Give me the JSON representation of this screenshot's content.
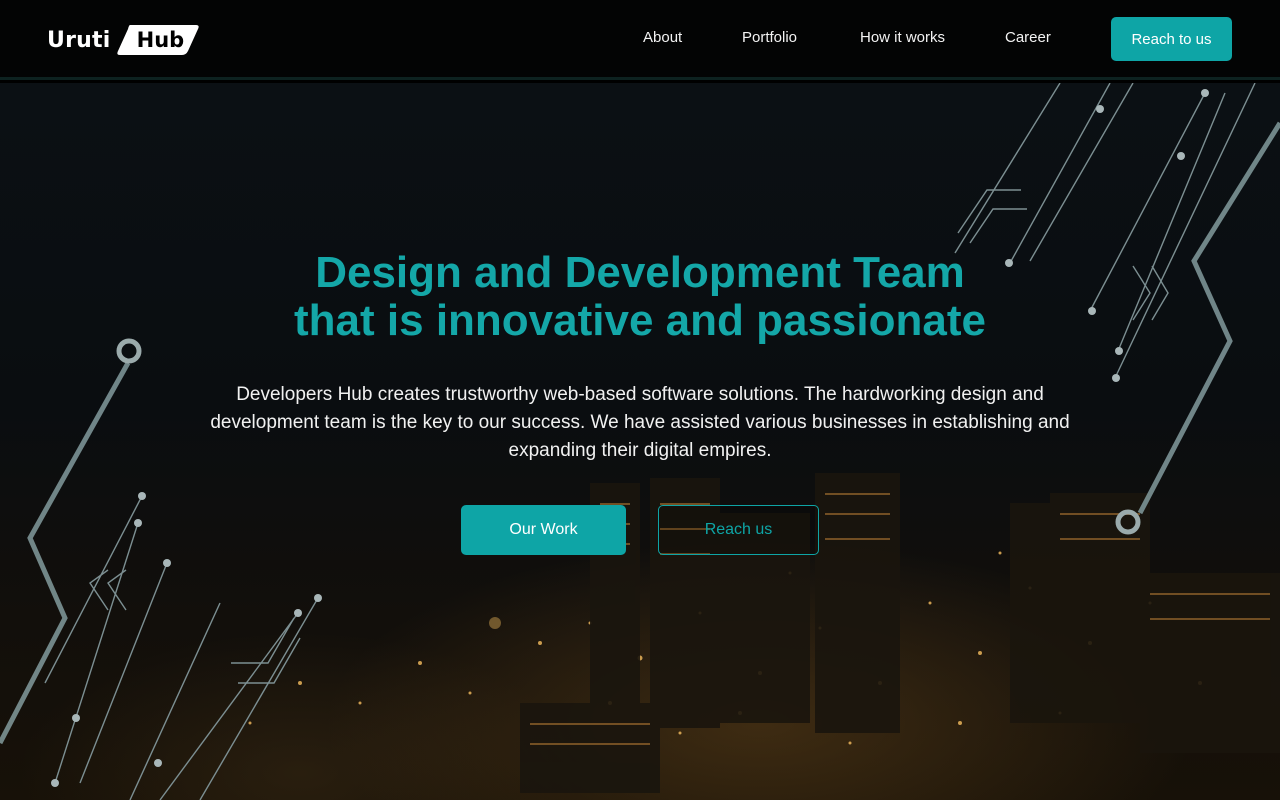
{
  "brand": {
    "word": "Uruti",
    "badge": "Hub"
  },
  "nav": {
    "links": [
      {
        "label": "About"
      },
      {
        "label": "Portfolio"
      },
      {
        "label": "How it works"
      },
      {
        "label": "Career"
      }
    ],
    "cta_label": "Reach to us"
  },
  "hero": {
    "headline_line1": "Design and Development Team",
    "headline_line2": "that is innovative and passionate",
    "description": "Developers Hub creates trustworthy web-based software solutions. The hardworking design and development team is the key to our success. We have assisted various businesses in establishing and expanding their digital empires.",
    "primary_button": "Our Work",
    "secondary_button": "Reach us",
    "background": "night-city-skyline-photo"
  },
  "colors": {
    "accent": "#0ea5a6",
    "nav_background": "#030404",
    "text": "#f1f1f1"
  }
}
